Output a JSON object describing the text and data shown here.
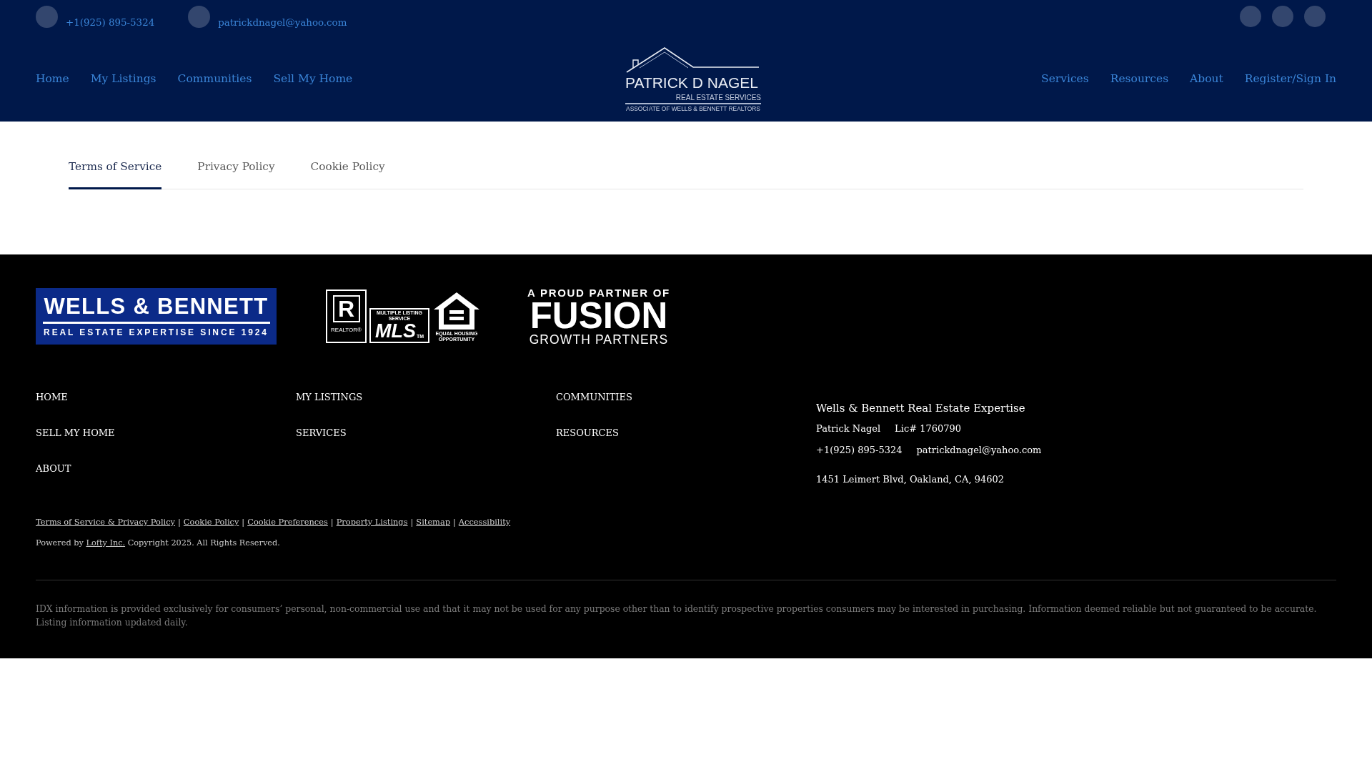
{
  "top_bar": {
    "contacts": [
      {
        "text": "+1(925) 895-5324"
      },
      {
        "text": "patrickdnagel@yahoo.com"
      }
    ]
  },
  "nav": {
    "left": [
      {
        "label": "Home"
      },
      {
        "label": "My Listings"
      },
      {
        "label": "Communities"
      },
      {
        "label": "Sell My Home"
      }
    ],
    "right": [
      {
        "label": "Services"
      },
      {
        "label": "Resources"
      },
      {
        "label": "About"
      },
      {
        "label": "Register/Sign In"
      }
    ]
  },
  "logo": {
    "name": "PATRICK D NAGEL",
    "subtitle": "REAL ESTATE SERVICES",
    "tagline": "ASSOCIATE OF WELLS & BENNETT REALTORS"
  },
  "tabs": [
    {
      "label": "Terms of Service",
      "selected": true
    },
    {
      "label": "Privacy Policy",
      "selected": false
    },
    {
      "label": "Cookie Policy",
      "selected": false
    }
  ],
  "footer": {
    "logos": {
      "brokerage": {
        "title": "WELLS & BENNETT",
        "tagline": "REAL ESTATE EXPERTISE SINCE 1924"
      },
      "mls": {
        "realtor_mark": "R",
        "realtor_label": "REALTOR®",
        "mls_caption": "MULTIPLE LISTING SERVICE",
        "mls_title": "MLS",
        "trademark": "TM",
        "equal_housing": "EQUAL HOUSING OPPORTUNITY"
      },
      "partner": {
        "intro": "A PROUD PARTNER OF",
        "name": "FUSION",
        "subtitle": "GROWTH PARTNERS"
      }
    },
    "nav_links": [
      {
        "label": "HOME"
      },
      {
        "label": "MY LISTINGS"
      },
      {
        "label": "COMMUNITIES"
      },
      {
        "label": "SELL MY HOME"
      },
      {
        "label": "SERVICES"
      },
      {
        "label": "RESOURCES"
      },
      {
        "label": "ABOUT"
      }
    ],
    "contact": {
      "company": "Wells & Bennett Real Estate Expertise",
      "agent": "Patrick Nagel",
      "license": "Lic# 1760790",
      "phone": "+1(925) 895-5324",
      "email": "patrickdnagel@yahoo.com",
      "address": "1451 Leimert Blvd, Oakland, CA, 94602"
    },
    "legal_links": {
      "items": [
        {
          "label": "Terms of Service & Privacy Policy"
        },
        {
          "label": "Cookie Policy"
        },
        {
          "label": "Cookie Preferences"
        },
        {
          "label": "Property Listings"
        },
        {
          "label": "Sitemap"
        },
        {
          "label": "Accessibility"
        }
      ],
      "separator": "|"
    },
    "powered_by": {
      "prefix": "Powered by",
      "link": "Lofty Inc.",
      "suffix": "Copyright 2025. All Rights Reserved."
    },
    "disclaimer": "IDX information is provided exclusively for consumers’ personal, non-commercial use and that it may not be used for any purpose other than to identify prospective properties consumers may be interested in purchasing. Information deemed reliable but not guaranteed to be accurate. Listing information updated daily."
  }
}
